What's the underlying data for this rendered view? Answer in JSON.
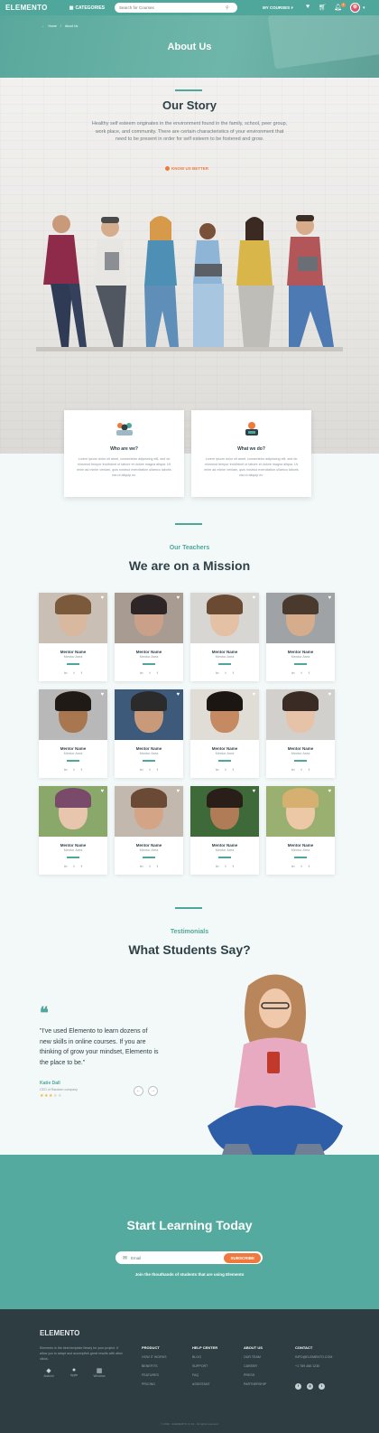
{
  "header": {
    "logo": "ELEMENTO",
    "categories_label": "CATEGORIES",
    "search_placeholder": "Search for Courses",
    "my_courses_label": "MY COURSES",
    "cart_badge": "4"
  },
  "hero": {
    "breadcrumb_home": "Home",
    "breadcrumb_sep": "/",
    "breadcrumb_current": "About Us",
    "title": "About Us"
  },
  "story": {
    "title": "Our Story",
    "text": "Healthy self esteem originates in the environment found in the family, school, peer group, work place, and community. There are certain characteristics of your environment that need to be present in order for self esteem to be fostered and grow.",
    "link": "KNOW US BETTER"
  },
  "info_cards": [
    {
      "title": "Who are we?",
      "text": "Lorem ipsum dolor sit amet, consectetur adipiscing elit, sed do eiusmod tempor incididunt ut labore et dolore magna aliqua. Ut enim ad minim veniam, quis nostrud exercitation ullamco laboris nisi ut aliquip ex."
    },
    {
      "title": "What we do?",
      "text": "Lorem ipsum dolor sit amet, consectetur adipiscing elit, sed do eiusmod tempor incididunt ut labore et dolore magna aliqua. Ut enim ad minim veniam, quis nostrud exercitation ullamco laboris nisi ut aliquip ex."
    }
  ],
  "teachers": {
    "subtitle": "Our Teachers",
    "title": "We are on a Mission",
    "mentors": [
      {
        "name": "Mentor Name",
        "area": "Mentor Area"
      },
      {
        "name": "Mentor Name",
        "area": "Mentor Area"
      },
      {
        "name": "Mentor Name",
        "area": "Mentor Area"
      },
      {
        "name": "Mentor Name",
        "area": "Mentor Area"
      },
      {
        "name": "Mentor Name",
        "area": "Mentor Area"
      },
      {
        "name": "Mentor Name",
        "area": "Mentor Area"
      },
      {
        "name": "Mentor Name",
        "area": "Mentor Area"
      },
      {
        "name": "Mentor Name",
        "area": "Mentor Area"
      },
      {
        "name": "Mentor Name",
        "area": "Mentor Area"
      },
      {
        "name": "Mentor Name",
        "area": "Mentor Area"
      },
      {
        "name": "Mentor Name",
        "area": "Mentor Area"
      },
      {
        "name": "Mentor Name",
        "area": "Mentor Area"
      }
    ]
  },
  "testimonials": {
    "subtitle": "Testimonials",
    "title": "What Students Say?",
    "quote": "\"I've used Elemento to learn dozens of new skills in online courses. If you are thinking of grow your mindset, Elemento is the place to be.\"",
    "author": "Katie Dall",
    "role": "CEO of Random company",
    "rating": 3,
    "rating_max": 5
  },
  "cta": {
    "title": "Start Learning Today",
    "email_placeholder": "Email",
    "subscribe_label": "SUBSCRIBE",
    "join_text": "Join the thouthands of students that are using Elemento"
  },
  "footer": {
    "logo": "ELEMENTO",
    "description": "Elemento is the best template library for your project. It allow you to adapt and accomplish great results with afew clicks.",
    "stores": [
      "Android",
      "Apple",
      "Windows"
    ],
    "columns": [
      {
        "title": "PRODUCT",
        "links": [
          "HOW IT WORKS",
          "BENEFITS",
          "FEATURES",
          "PRICING"
        ]
      },
      {
        "title": "HELP CENTER",
        "links": [
          "BLOG",
          "SUPPORT",
          "FAQ",
          "ASSISTANT"
        ]
      },
      {
        "title": "ABOUT US",
        "links": [
          "OUR TEAM",
          "CAREER",
          "PRESS",
          "PARTNERSHIP"
        ]
      },
      {
        "title": "CONTACT",
        "links": [
          "INFO@ELEMENTO.COM",
          "+1 789 456 1230"
        ]
      }
    ],
    "copyright": "© 2020 · ELEMENTO UI Kit · All rights reserved"
  },
  "colors": {
    "accent": "#4fa79b",
    "orange": "#f07a3e",
    "dark": "#2e3d42"
  }
}
